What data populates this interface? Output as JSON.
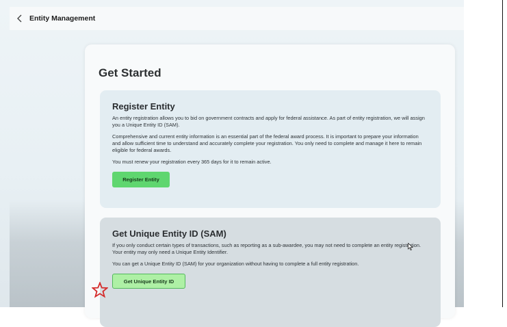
{
  "header": {
    "title": "Entity Management",
    "back_icon": "chevron-left-icon"
  },
  "page": {
    "title": "Get Started"
  },
  "register_section": {
    "title": "Register Entity",
    "paragraphs": [
      "An entity registration allows you to bid on government contracts and apply for federal assistance. As part of entity registration, we will assign you a Unique Entity ID (SAM).",
      "Comprehensive and current entity information is an essential part of the federal award process. It is important to prepare your information and allow sufficient time to understand and accurately complete your registration. You only need to complete and manage it here to remain eligible for federal awards.",
      "You must renew your registration every 365 days for it to remain active."
    ],
    "button_label": "Register Entity"
  },
  "uei_section": {
    "title": "Get Unique Entity ID (SAM)",
    "paragraphs": [
      "If you only conduct certain types of transactions, such as reporting as a sub-awardee, you may not need to complete an entity registration. Your entity may only need a Unique Entity Identifier.",
      "You can get a Unique Entity ID (SAM) for your organization without having to complete a full entity registration."
    ],
    "button_label": "Get Unique Entity ID"
  },
  "annotation": {
    "icon": "star-outline-icon",
    "color": "#d42a2a"
  },
  "colors": {
    "primary_button": "#5fd66f",
    "secondary_button": "#aef0a5",
    "section_bg": "#e3edf2"
  }
}
